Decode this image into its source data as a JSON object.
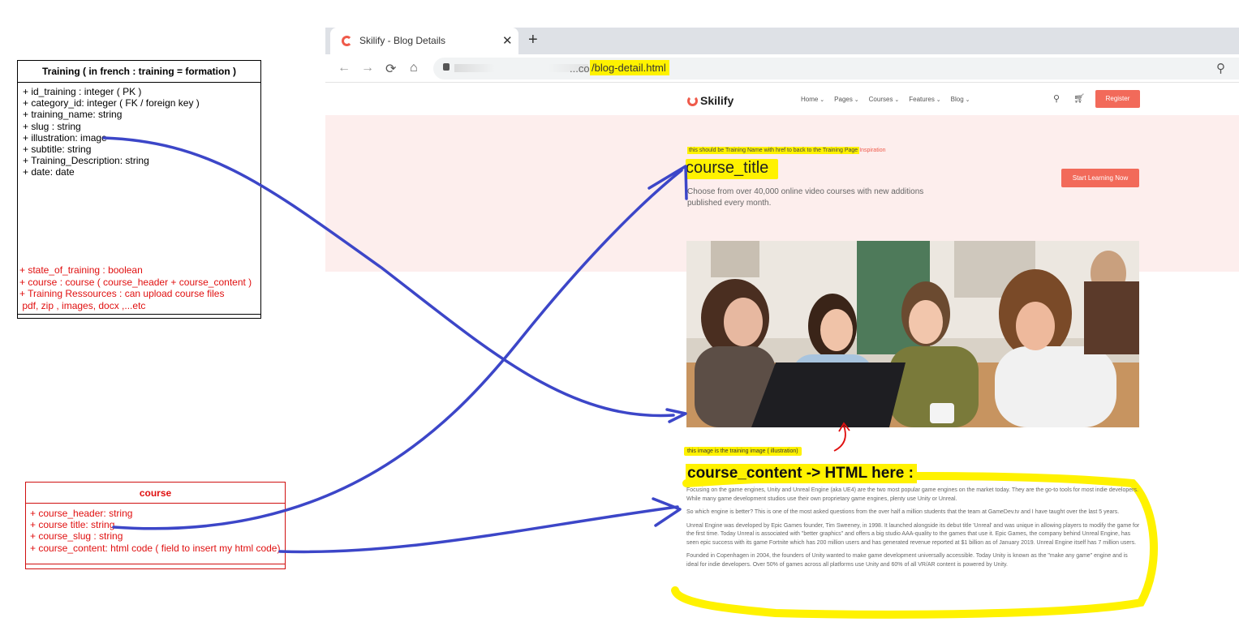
{
  "training_uml": {
    "title": "Training ( in french : training = formation )",
    "attributes": [
      "+ id_training : integer ( PK )",
      "+ category_id: integer ( FK / foreign key )",
      "+ training_name: string",
      "+ slug : string",
      "+ illustration: image",
      "+ subtitle: string",
      "+ Training_Description: string",
      "+ date: date"
    ],
    "red_attributes": [
      "+ state_of_training : boolean",
      "+ course : course ( course_header + course_content )",
      "+ Training Ressources : can upload course files",
      " pdf, zip , images, docx ,...etc"
    ]
  },
  "course_uml": {
    "title": "course",
    "attributes": [
      "+ course_header: string",
      "+ course title: string",
      "+ course_slug : string",
      "+ course_content: html code ( field to insert my html code)"
    ]
  },
  "browser": {
    "tab_title": "Skilify - Blog Details",
    "url_host": "...com",
    "url_path": "/blog-detail.html"
  },
  "site": {
    "logo": "Skilify",
    "menu": [
      "Home",
      "Pages",
      "Courses",
      "Features",
      "Blog"
    ],
    "register": "Register",
    "breadcrumb_note": "this should be Training Name with href to back to the Training Page",
    "breadcrumb_suffix": "Inspiration",
    "course_title": "course_title",
    "subtitle": "Choose from over 40,000 online video courses with new additions published every month.",
    "start_button": "Start Learning Now",
    "image_note": "this image is the training image ( illustration)",
    "content_title": "course_content -> HTML here :",
    "paragraphs": [
      "Focusing on the game engines, Unity and Unreal Engine (aka UE4) are the two most popular game engines on the market today. They are the go-to tools for most indie developers. While many game development studios use their own proprietary game engines, plenty use Unity or Unreal.",
      "So which engine is better? This is one of the most asked questions from the over half a million students that the team at GameDev.tv and I have taught over the last 5 years.",
      "Unreal Engine was developed by Epic Games founder, Tim Sweeney, in 1998. It launched alongside its debut title 'Unreal' and was unique in allowing players to modify the game for the first time. Today Unreal is associated with \"better graphics\" and offers a big studio AAA-quality to the games that use it. Epic Games, the company behind Unreal Engine, has seen epic success with its game Fortnite which has 200 million users and has generated revenue reported at $1 billion as of January 2019. Unreal Engine itself has 7 million users.",
      "Founded in Copenhagen in 2004, the founders of Unity wanted to make game development universally accessible. Today Unity is known as the \"make any game\" engine and is ideal for indie developers. Over 50% of games across all platforms use Unity and 60% of all VR/AR content is powered by Unity."
    ]
  },
  "colors": {
    "accent": "#f26a5a",
    "highlight": "#fff200",
    "arrow": "#3c46c8",
    "uml_red": "#e01010",
    "hero_bg": "#fdeeed"
  }
}
